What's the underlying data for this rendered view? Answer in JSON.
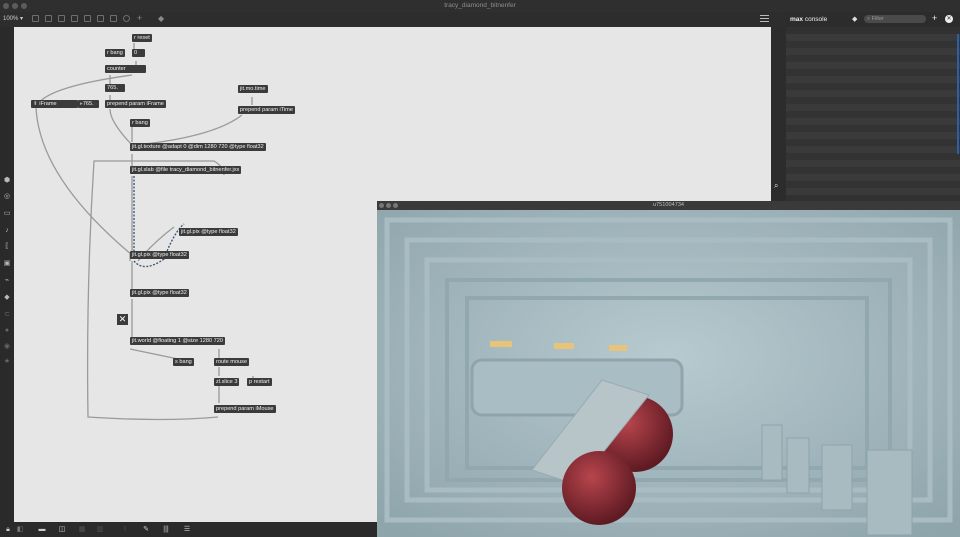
{
  "window": {
    "title": "tracy_diamond_bitnenfer"
  },
  "toolbar": {
    "zoom": "100%"
  },
  "console": {
    "title_bold": "max",
    "title_rest": "console",
    "filter_placeholder": "Filter"
  },
  "render_window": {
    "title": "u751004734"
  },
  "patch": {
    "objects": [
      {
        "id": "r_reset",
        "text": "r reset"
      },
      {
        "id": "r_bang_1",
        "text": "r bang"
      },
      {
        "id": "msg_zero",
        "text": "0"
      },
      {
        "id": "counter",
        "text": "counter"
      },
      {
        "id": "num_765_a",
        "text": "765."
      },
      {
        "id": "iframe_label",
        "text": "iFrame"
      },
      {
        "id": "num_765_b",
        "text": "765."
      },
      {
        "id": "prepend_iframe",
        "text": "prepend param iFrame"
      },
      {
        "id": "jit_mo_time",
        "text": "jit.mo.time"
      },
      {
        "id": "prepend_itime",
        "text": "prepend param iTime"
      },
      {
        "id": "r_bang_2",
        "text": "r bang"
      },
      {
        "id": "jit_gl_texture",
        "text": "jit.gl.texture @adapt 0 @dim 1280 720 @type float32"
      },
      {
        "id": "jit_gl_slab",
        "text": "jit.gl.slab @file tracy_diamond_bitnenfer.jxs"
      },
      {
        "id": "jit_gl_pix_a",
        "text": "jit.gl.pix @type float32"
      },
      {
        "id": "jit_gl_pix_b",
        "text": "jit.gl.pix @type float32"
      },
      {
        "id": "jit_gl_pix_c",
        "text": "jit.gl.pix @type float32"
      },
      {
        "id": "jit_world",
        "text": "jit.world @floating 1 @size 1280 720"
      },
      {
        "id": "s_bang",
        "text": "s bang"
      },
      {
        "id": "route_mouse",
        "text": "route mouse"
      },
      {
        "id": "zl_slice",
        "text": "zl.slice 3"
      },
      {
        "id": "p_restart",
        "text": "p restart"
      },
      {
        "id": "prepend_imouse",
        "text": "prepend param iMouse"
      }
    ]
  },
  "icons": [
    "lock-icon",
    "presentation-icon",
    "new-view-icon",
    "grid-icon",
    "wrench-icon",
    "mixer-icon",
    "debug-icon",
    "search-icon",
    "add-icon",
    "clear-icon",
    "list-icon",
    "toggle-x-icon"
  ],
  "colors": {
    "canvas": "#e6e6e6",
    "object": "#3b3b3b",
    "chrome": "#2b2b2b",
    "console": "#313131"
  }
}
